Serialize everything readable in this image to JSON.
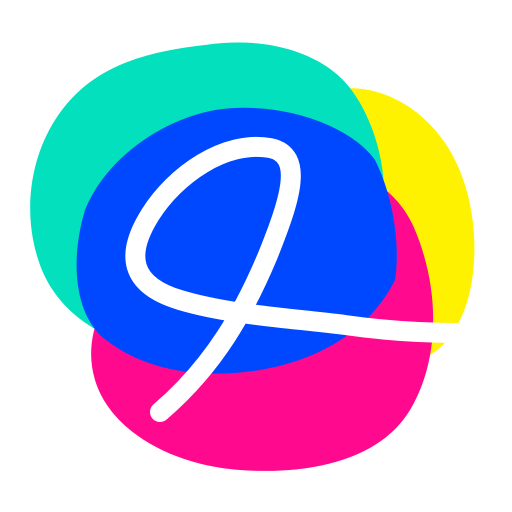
{
  "app_icon": {
    "name": "script-letter-logo",
    "colors": {
      "background": "#ffffff",
      "teal": "#03e0be",
      "yellow": "#fff200",
      "magenta": "#ff0a8e",
      "blue": "#0048ff",
      "stroke": "#ffffff"
    }
  }
}
